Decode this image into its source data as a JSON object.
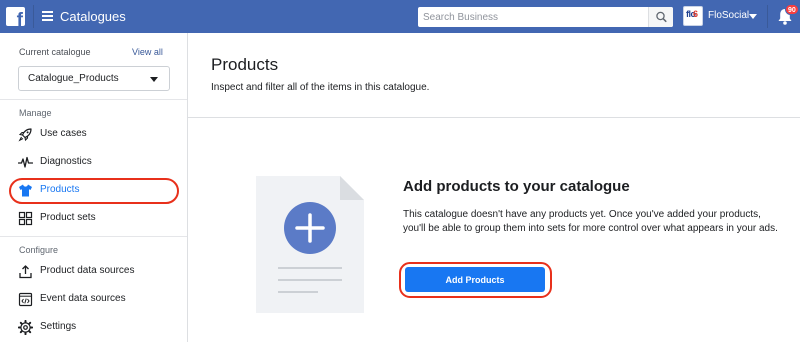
{
  "topbar": {
    "logo_letter": "f",
    "title": "Catalogues",
    "search_placeholder": "Search Business",
    "page_logo_text": "flo",
    "page_logo_accent": "6",
    "page_name": "FloSocial",
    "notification_count": "90"
  },
  "sidebar": {
    "current_label": "Current catalogue",
    "view_all": "View all",
    "catalogue_selected": "Catalogue_Products",
    "manage_label": "Manage",
    "manage_items": [
      {
        "label": "Use cases",
        "icon": "rocket-icon"
      },
      {
        "label": "Diagnostics",
        "icon": "pulse-icon"
      },
      {
        "label": "Products",
        "icon": "tshirt-icon",
        "active": true
      },
      {
        "label": "Product sets",
        "icon": "grid-icon"
      }
    ],
    "configure_label": "Configure",
    "configure_items": [
      {
        "label": "Product data sources",
        "icon": "upload-icon"
      },
      {
        "label": "Event data sources",
        "icon": "code-window-icon"
      },
      {
        "label": "Settings",
        "icon": "gear-icon"
      }
    ]
  },
  "main": {
    "title": "Products",
    "subtitle": "Inspect and filter all of the items in this catalogue.",
    "empty_title": "Add products to your catalogue",
    "empty_desc": "This catalogue doesn't have any products yet. Once you've added your products, you'll be able to group them into sets for more control over what appears in your ads.",
    "add_button": "Add Products"
  },
  "colors": {
    "topbar": "#4267b2",
    "accent": "#1877f2",
    "annotation": "#e8301b",
    "illustration_circle": "#5b7bc7"
  }
}
